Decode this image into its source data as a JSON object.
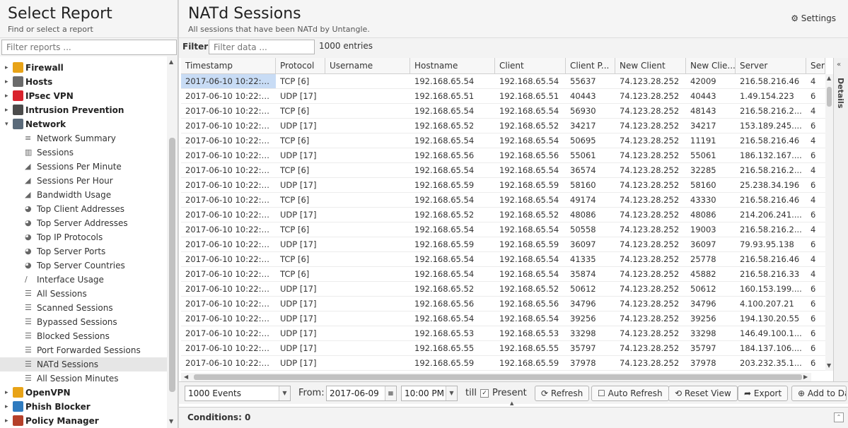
{
  "left": {
    "title": "Select Report",
    "subtitle": "Find or select a report",
    "filter_placeholder": "Filter reports ..."
  },
  "tree": [
    {
      "type": "cat",
      "label": "Firewall",
      "toggle": "▸",
      "color": "#e8a317"
    },
    {
      "type": "cat",
      "label": "Hosts",
      "toggle": "▸",
      "color": "#6b6b6b"
    },
    {
      "type": "cat",
      "label": "IPsec VPN",
      "toggle": "▸",
      "color": "#d9232d"
    },
    {
      "type": "cat",
      "label": "Intrusion Prevention",
      "toggle": "▸",
      "color": "#4b4b4b"
    },
    {
      "type": "cat",
      "label": "Network",
      "toggle": "▾",
      "color": "#5a6a7a"
    },
    {
      "type": "leaf",
      "label": "Network Summary",
      "icon": "≡"
    },
    {
      "type": "leaf",
      "label": "Sessions",
      "icon": "▥"
    },
    {
      "type": "leaf",
      "label": "Sessions Per Minute",
      "icon": "◢"
    },
    {
      "type": "leaf",
      "label": "Sessions Per Hour",
      "icon": "◢"
    },
    {
      "type": "leaf",
      "label": "Bandwidth Usage",
      "icon": "◢"
    },
    {
      "type": "leaf",
      "label": "Top Client Addresses",
      "icon": "◕"
    },
    {
      "type": "leaf",
      "label": "Top Server Addresses",
      "icon": "◕"
    },
    {
      "type": "leaf",
      "label": "Top IP Protocols",
      "icon": "◕"
    },
    {
      "type": "leaf",
      "label": "Top Server Ports",
      "icon": "◕"
    },
    {
      "type": "leaf",
      "label": "Top Server Countries",
      "icon": "◕"
    },
    {
      "type": "leaf",
      "label": "Interface Usage",
      "icon": "∕"
    },
    {
      "type": "leaf",
      "label": "All Sessions",
      "icon": "☰"
    },
    {
      "type": "leaf",
      "label": "Scanned Sessions",
      "icon": "☰"
    },
    {
      "type": "leaf",
      "label": "Bypassed Sessions",
      "icon": "☰"
    },
    {
      "type": "leaf",
      "label": "Blocked Sessions",
      "icon": "☰"
    },
    {
      "type": "leaf",
      "label": "Port Forwarded Sessions",
      "icon": "☰"
    },
    {
      "type": "leaf",
      "label": "NATd Sessions",
      "icon": "☰",
      "selected": true
    },
    {
      "type": "leaf",
      "label": "All Session Minutes",
      "icon": "☰"
    },
    {
      "type": "cat",
      "label": "OpenVPN",
      "toggle": "▸",
      "color": "#e8a317"
    },
    {
      "type": "cat",
      "label": "Phish Blocker",
      "toggle": "▸",
      "color": "#2f7bbf"
    },
    {
      "type": "cat",
      "label": "Policy Manager",
      "toggle": "▸",
      "color": "#b5402a"
    }
  ],
  "main": {
    "title": "NATd Sessions",
    "subtitle": "All sessions that have been NATd by Untangle.",
    "settings_label": "Settings",
    "filter_label": "Filter:",
    "filter_placeholder": "Filter data ...",
    "entries": "1000 entries",
    "details_label": "Details"
  },
  "grid": {
    "columns": [
      "Timestamp",
      "Protocol",
      "Username",
      "Hostname",
      "Client",
      "Client P...",
      "New Client",
      "New Clie...",
      "Server",
      "Ser"
    ],
    "rows": [
      [
        "2017-06-10 10:22:4...",
        "TCP [6]",
        "",
        "192.168.65.54",
        "192.168.65.54",
        "55637",
        "74.123.28.252",
        "42009",
        "216.58.216.46",
        "4"
      ],
      [
        "2017-06-10 10:22:4...",
        "UDP [17]",
        "",
        "192.168.65.51",
        "192.168.65.51",
        "40443",
        "74.123.28.252",
        "40443",
        "1.49.154.223",
        "6"
      ],
      [
        "2017-06-10 10:22:4...",
        "TCP [6]",
        "",
        "192.168.65.54",
        "192.168.65.54",
        "56930",
        "74.123.28.252",
        "48143",
        "216.58.216.2...",
        "4"
      ],
      [
        "2017-06-10 10:22:3...",
        "UDP [17]",
        "",
        "192.168.65.52",
        "192.168.65.52",
        "34217",
        "74.123.28.252",
        "34217",
        "153.189.245....",
        "6"
      ],
      [
        "2017-06-10 10:22:3...",
        "TCP [6]",
        "",
        "192.168.65.54",
        "192.168.65.54",
        "50695",
        "74.123.28.252",
        "11191",
        "216.58.216.46",
        "4"
      ],
      [
        "2017-06-10 10:22:3...",
        "UDP [17]",
        "",
        "192.168.65.56",
        "192.168.65.56",
        "55061",
        "74.123.28.252",
        "55061",
        "186.132.167....",
        "6"
      ],
      [
        "2017-06-10 10:22:3...",
        "TCP [6]",
        "",
        "192.168.65.54",
        "192.168.65.54",
        "36574",
        "74.123.28.252",
        "32285",
        "216.58.216.2...",
        "4"
      ],
      [
        "2017-06-10 10:22:3...",
        "UDP [17]",
        "",
        "192.168.65.59",
        "192.168.65.59",
        "58160",
        "74.123.28.252",
        "58160",
        "25.238.34.196",
        "6"
      ],
      [
        "2017-06-10 10:22:3...",
        "TCP [6]",
        "",
        "192.168.65.54",
        "192.168.65.54",
        "49174",
        "74.123.28.252",
        "43330",
        "216.58.216.46",
        "4"
      ],
      [
        "2017-06-10 10:22:3...",
        "UDP [17]",
        "",
        "192.168.65.52",
        "192.168.65.52",
        "48086",
        "74.123.28.252",
        "48086",
        "214.206.241....",
        "6"
      ],
      [
        "2017-06-10 10:22:3...",
        "TCP [6]",
        "",
        "192.168.65.54",
        "192.168.65.54",
        "50558",
        "74.123.28.252",
        "19003",
        "216.58.216.2...",
        "4"
      ],
      [
        "2017-06-10 10:22:3...",
        "UDP [17]",
        "",
        "192.168.65.59",
        "192.168.65.59",
        "36097",
        "74.123.28.252",
        "36097",
        "79.93.95.138",
        "6"
      ],
      [
        "2017-06-10 10:22:3...",
        "TCP [6]",
        "",
        "192.168.65.54",
        "192.168.65.54",
        "41335",
        "74.123.28.252",
        "25778",
        "216.58.216.46",
        "4"
      ],
      [
        "2017-06-10 10:22:3...",
        "TCP [6]",
        "",
        "192.168.65.54",
        "192.168.65.54",
        "35874",
        "74.123.28.252",
        "45882",
        "216.58.216.33",
        "4"
      ],
      [
        "2017-06-10 10:22:3...",
        "UDP [17]",
        "",
        "192.168.65.52",
        "192.168.65.52",
        "50612",
        "74.123.28.252",
        "50612",
        "160.153.199....",
        "6"
      ],
      [
        "2017-06-10 10:22:3...",
        "UDP [17]",
        "",
        "192.168.65.56",
        "192.168.65.56",
        "34796",
        "74.123.28.252",
        "34796",
        "4.100.207.21",
        "6"
      ],
      [
        "2017-06-10 10:22:3...",
        "UDP [17]",
        "",
        "192.168.65.54",
        "192.168.65.54",
        "39256",
        "74.123.28.252",
        "39256",
        "194.130.20.55",
        "6"
      ],
      [
        "2017-06-10 10:22:3...",
        "UDP [17]",
        "",
        "192.168.65.53",
        "192.168.65.53",
        "33298",
        "74.123.28.252",
        "33298",
        "146.49.100.1...",
        "6"
      ],
      [
        "2017-06-10 10:22:2...",
        "UDP [17]",
        "",
        "192.168.65.55",
        "192.168.65.55",
        "35797",
        "74.123.28.252",
        "35797",
        "184.137.106....",
        "6"
      ],
      [
        "2017-06-10 10:22:2...",
        "UDP [17]",
        "",
        "192.168.65.59",
        "192.168.65.59",
        "37978",
        "74.123.28.252",
        "37978",
        "203.232.35.1...",
        "6"
      ]
    ]
  },
  "toolbar": {
    "events_value": "1000 Events",
    "from_label": "From:",
    "from_date": "2017-06-09",
    "from_time": "10:00 PM",
    "till_label": "till",
    "present_label": "Present",
    "refresh_label": "Refresh",
    "auto_refresh_label": "Auto Refresh",
    "reset_view_label": "Reset View",
    "export_label": "Export",
    "add_label": "Add to Da"
  },
  "conditions": {
    "label": "Conditions: 0"
  }
}
